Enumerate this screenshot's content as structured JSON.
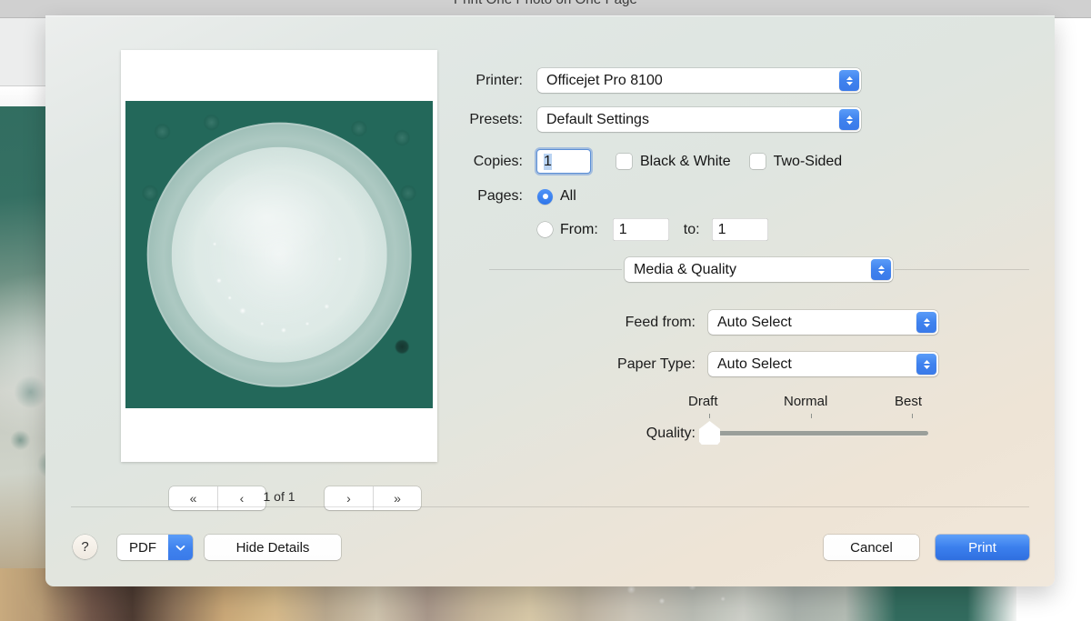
{
  "window": {
    "title": "Print One Photo on One Page"
  },
  "preview": {
    "photo_description": "frozen-flower-in-glass-dish",
    "nav": {
      "first_label": "«",
      "prev_label": "‹",
      "next_label": "›",
      "last_label": "»",
      "page_indicator": "1 of 1"
    }
  },
  "options": {
    "printer": {
      "label": "Printer:",
      "value": "Officejet Pro 8100"
    },
    "presets": {
      "label": "Presets:",
      "value": "Default Settings"
    },
    "copies": {
      "label": "Copies:",
      "value": "1",
      "black_and_white": "Black & White",
      "two_sided": "Two-Sided"
    },
    "pages": {
      "label": "Pages:",
      "all_label": "All",
      "from_label": "From:",
      "from_value": "1",
      "to_label": "to:",
      "to_value": "1",
      "selected": "All"
    },
    "pane_popup": {
      "value": "Media & Quality"
    },
    "feed_from": {
      "label": "Feed from:",
      "value": "Auto Select"
    },
    "paper_type": {
      "label": "Paper Type:",
      "value": "Auto Select"
    },
    "quality": {
      "label": "Quality:",
      "tick_draft": "Draft",
      "tick_normal": "Normal",
      "tick_best": "Best",
      "value": "Draft"
    }
  },
  "toolbar": {
    "help_label": "?",
    "pdf_label": "PDF",
    "hide_details_label": "Hide Details",
    "cancel_label": "Cancel",
    "print_label": "Print"
  },
  "colors": {
    "accent_blue": "#3b7fed",
    "stepper_blue": "#3f82ee",
    "radio_blue": "#2f76ea",
    "focus_ring": "#5b8fd6",
    "sheet_bg": "#e2e8e5"
  }
}
